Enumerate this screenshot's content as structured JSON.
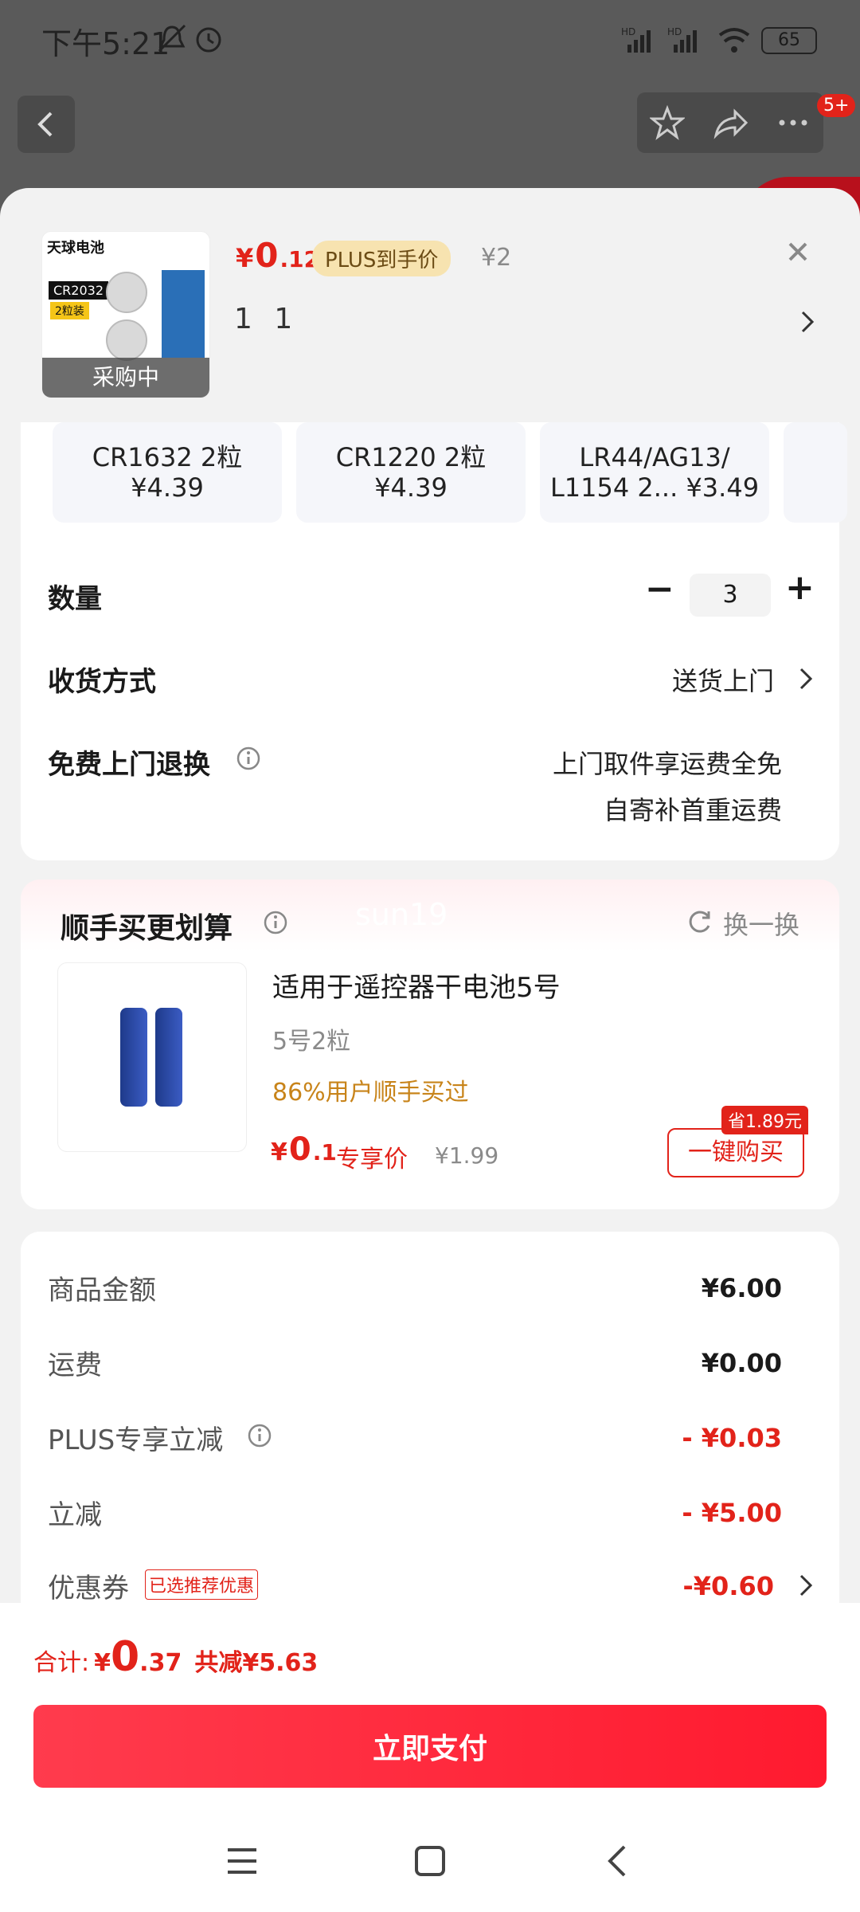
{
  "status_bar": {
    "time": "下午5:21",
    "battery": "65"
  },
  "top": {
    "notif_badge": "5+"
  },
  "product": {
    "brand": "天球电池",
    "model": "CR2032",
    "pack": "2粒装",
    "purchasing_label": "采购中",
    "currency": "¥",
    "price_int": "0",
    "price_dec": ".12",
    "plus_tag": "PLUS到手价",
    "orig_price": "¥2",
    "spec_selected": "1 1"
  },
  "specs": [
    {
      "line1": "CR1632 2粒",
      "line2": "¥4.39"
    },
    {
      "line1": "CR1220 2粒",
      "line2": "¥4.39"
    },
    {
      "line1": "LR44/AG13/",
      "line2": "L1154 2... ¥3.49"
    }
  ],
  "quantity": {
    "label": "数量",
    "value": "3",
    "minus": "−",
    "plus": "+"
  },
  "delivery": {
    "label": "收货方式",
    "value": "送货上门"
  },
  "return": {
    "label": "免费上门退换",
    "line1": "上门取件享运费全免",
    "line2": "自寄补首重运费"
  },
  "addon": {
    "title": "顺手买更划算",
    "watermark": "sun19",
    "refresh": "换一换",
    "product_title": "适用于遥控器干电池5号",
    "spec": "5号2粒",
    "social": "86%用户顺手买过",
    "currency": "¥",
    "price_int": "0",
    "price_dec": ".1",
    "price_tag": "专享价",
    "orig_price": "¥1.99",
    "save_badge": "省1.89元",
    "buy_button": "一键购买"
  },
  "summary": {
    "rows": [
      {
        "label": "商品金额",
        "value": "¥6.00"
      },
      {
        "label": "运费",
        "value": "¥0.00"
      },
      {
        "label": "PLUS专享立减",
        "value": "- ¥0.03"
      },
      {
        "label": "立减",
        "value": "- ¥5.00"
      },
      {
        "label": "优惠券",
        "value": "-¥0.60",
        "tag": "已选推荐优惠"
      }
    ]
  },
  "footer": {
    "total_label": "合计:",
    "currency": "¥",
    "total_int": "0",
    "total_dec": ".37",
    "saved": "共减¥5.63",
    "pay_button": "立即支付"
  },
  "colors": {
    "accent": "#e2231a",
    "plus_tag_bg": "#f7e3b0",
    "pay_button": "#ff1a2f"
  }
}
